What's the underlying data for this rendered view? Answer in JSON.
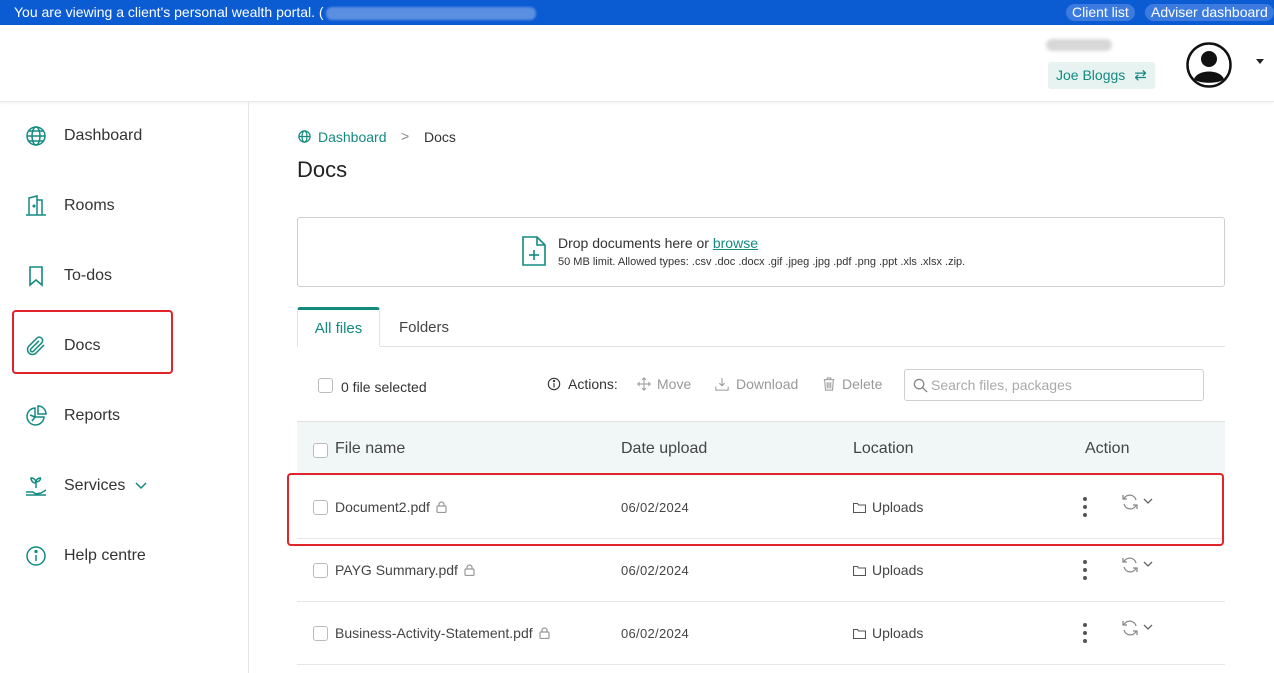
{
  "banner": {
    "message": "You are viewing a client's personal wealth portal. (",
    "client_list": "Client list",
    "adviser_dashboard": "Adviser dashboard"
  },
  "header": {
    "user_name": "Joe Bloggs",
    "swap_icon": "⇄"
  },
  "sidebar": {
    "items": [
      {
        "label": "Dashboard",
        "icon": "globe-icon"
      },
      {
        "label": "Rooms",
        "icon": "building-icon"
      },
      {
        "label": "To-dos",
        "icon": "bookmark-icon"
      },
      {
        "label": "Docs",
        "icon": "paperclip-icon"
      },
      {
        "label": "Reports",
        "icon": "pie-chart-icon"
      },
      {
        "label": "Services",
        "icon": "plant-hand-icon"
      },
      {
        "label": "Help centre",
        "icon": "info-icon"
      }
    ]
  },
  "breadcrumb": {
    "home": "Dashboard",
    "separator": ">",
    "current": "Docs"
  },
  "page": {
    "title": "Docs"
  },
  "dropzone": {
    "text": "Drop documents here or ",
    "browse": "browse",
    "limits": "50 MB limit. Allowed types: .csv .doc .docx .gif .jpeg .jpg .pdf .png .ppt .xls .xlsx .zip."
  },
  "tabs": [
    {
      "label": "All files",
      "active": true
    },
    {
      "label": "Folders",
      "active": false
    }
  ],
  "toolbar": {
    "selected": "0 file selected",
    "actions_label": "Actions:",
    "move": "Move",
    "download": "Download",
    "delete": "Delete",
    "search_placeholder": "Search files, packages"
  },
  "table": {
    "columns": [
      "File name",
      "Date upload",
      "Location",
      "Action"
    ],
    "rows": [
      {
        "name": "Document2.pdf",
        "date": "06/02/2024",
        "location": "Uploads"
      },
      {
        "name": "PAYG Summary.pdf",
        "date": "06/02/2024",
        "location": "Uploads"
      },
      {
        "name": "Business-Activity-Statement.pdf",
        "date": "06/02/2024",
        "location": "Uploads"
      }
    ]
  },
  "colors": {
    "banner": "#0b5bd3",
    "accent": "#138a80",
    "highlight": "#e0242a"
  }
}
